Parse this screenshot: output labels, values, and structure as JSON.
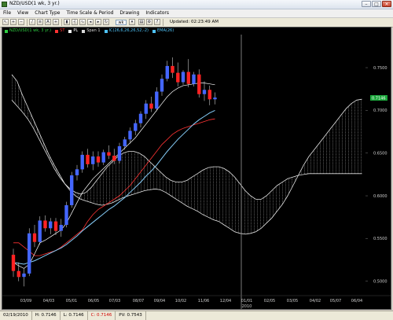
{
  "window": {
    "title": "NZD/USD(1 wk, 3 yr.)"
  },
  "menu": [
    "File",
    "View",
    "Chart Type",
    "Time Scale & Period",
    "Drawing",
    "Indicators"
  ],
  "toolbar": {
    "timeframe": "wk",
    "updated": "Updated: 02:23:49 AM"
  },
  "legend": [
    {
      "label": "NZD/USD(1 wk, 3 yr.)",
      "color": "#2ecc40"
    },
    {
      "label": "ST",
      "color": "#ff3333"
    },
    {
      "label": "PL",
      "color": "#ffffff"
    },
    {
      "label": "Span 1",
      "color": "#d9d9d9"
    },
    {
      "label": "IC(26,6,26,26,52,-2)",
      "color": "#4fc3f7"
    },
    {
      "label": "EMA(26)",
      "color": "#4fc3f7"
    }
  ],
  "chart_data": {
    "type": "candlestick",
    "title": "NZD/USD(1 wk, 3 yr.)",
    "y_ticks": [
      "0.7500",
      "0.7000",
      "0.6500",
      "0.6000",
      "0.5500",
      "0.5000"
    ],
    "current_price_label": "0.7146",
    "x_ticks": [
      "03/09",
      "04/03",
      "05/01",
      "06/05",
      "07/03",
      "08/07",
      "09/04",
      "10/02",
      "11/06",
      "12/04",
      "01/01",
      "02/05",
      "03/05",
      "04/02",
      "05/07",
      "06/04"
    ],
    "year_label": "2010",
    "ylim": [
      0.485,
      0.785
    ],
    "colors": {
      "up": "#4466ff",
      "down": "#ff2222",
      "kijun": "#ff3333",
      "tenkan": "#ffffff",
      "ema": "#87cefa",
      "cloud": "#e8e8e8"
    },
    "candles": [
      {
        "o": 0.531,
        "h": 0.538,
        "l": 0.505,
        "c": 0.512
      },
      {
        "o": 0.512,
        "h": 0.522,
        "l": 0.5,
        "c": 0.505
      },
      {
        "o": 0.505,
        "h": 0.515,
        "l": 0.494,
        "c": 0.509
      },
      {
        "o": 0.509,
        "h": 0.562,
        "l": 0.506,
        "c": 0.556
      },
      {
        "o": 0.556,
        "h": 0.566,
        "l": 0.54,
        "c": 0.546
      },
      {
        "o": 0.546,
        "h": 0.576,
        "l": 0.543,
        "c": 0.571
      },
      {
        "o": 0.571,
        "h": 0.577,
        "l": 0.558,
        "c": 0.562
      },
      {
        "o": 0.562,
        "h": 0.574,
        "l": 0.555,
        "c": 0.57
      },
      {
        "o": 0.57,
        "h": 0.574,
        "l": 0.554,
        "c": 0.559
      },
      {
        "o": 0.559,
        "h": 0.573,
        "l": 0.552,
        "c": 0.566
      },
      {
        "o": 0.566,
        "h": 0.593,
        "l": 0.563,
        "c": 0.589
      },
      {
        "o": 0.589,
        "h": 0.628,
        "l": 0.586,
        "c": 0.624
      },
      {
        "o": 0.624,
        "h": 0.636,
        "l": 0.618,
        "c": 0.631
      },
      {
        "o": 0.631,
        "h": 0.652,
        "l": 0.627,
        "c": 0.648
      },
      {
        "o": 0.648,
        "h": 0.655,
        "l": 0.633,
        "c": 0.637
      },
      {
        "o": 0.637,
        "h": 0.652,
        "l": 0.63,
        "c": 0.646
      },
      {
        "o": 0.646,
        "h": 0.652,
        "l": 0.634,
        "c": 0.639
      },
      {
        "o": 0.639,
        "h": 0.654,
        "l": 0.636,
        "c": 0.651
      },
      {
        "o": 0.651,
        "h": 0.659,
        "l": 0.643,
        "c": 0.647
      },
      {
        "o": 0.647,
        "h": 0.655,
        "l": 0.637,
        "c": 0.641
      },
      {
        "o": 0.641,
        "h": 0.662,
        "l": 0.638,
        "c": 0.658
      },
      {
        "o": 0.658,
        "h": 0.669,
        "l": 0.654,
        "c": 0.666
      },
      {
        "o": 0.666,
        "h": 0.68,
        "l": 0.661,
        "c": 0.676
      },
      {
        "o": 0.676,
        "h": 0.689,
        "l": 0.671,
        "c": 0.685
      },
      {
        "o": 0.685,
        "h": 0.699,
        "l": 0.68,
        "c": 0.696
      },
      {
        "o": 0.696,
        "h": 0.712,
        "l": 0.69,
        "c": 0.708
      },
      {
        "o": 0.708,
        "h": 0.716,
        "l": 0.698,
        "c": 0.702
      },
      {
        "o": 0.702,
        "h": 0.727,
        "l": 0.699,
        "c": 0.722
      },
      {
        "o": 0.722,
        "h": 0.742,
        "l": 0.717,
        "c": 0.737
      },
      {
        "o": 0.737,
        "h": 0.758,
        "l": 0.734,
        "c": 0.752
      },
      {
        "o": 0.752,
        "h": 0.762,
        "l": 0.738,
        "c": 0.744
      },
      {
        "o": 0.744,
        "h": 0.756,
        "l": 0.728,
        "c": 0.733
      },
      {
        "o": 0.733,
        "h": 0.747,
        "l": 0.73,
        "c": 0.745
      },
      {
        "o": 0.745,
        "h": 0.76,
        "l": 0.727,
        "c": 0.731
      },
      {
        "o": 0.731,
        "h": 0.745,
        "l": 0.728,
        "c": 0.742
      },
      {
        "o": 0.742,
        "h": 0.748,
        "l": 0.715,
        "c": 0.719
      },
      {
        "o": 0.719,
        "h": 0.734,
        "l": 0.711,
        "c": 0.724
      },
      {
        "o": 0.724,
        "h": 0.729,
        "l": 0.706,
        "c": 0.713
      },
      {
        "o": 0.713,
        "h": 0.721,
        "l": 0.707,
        "c": 0.715
      }
    ]
  },
  "status": [
    "02/19/2010",
    "H: 0.7146",
    "L: 0.7146",
    "C: 0.7146",
    "PV: 0.7543"
  ]
}
